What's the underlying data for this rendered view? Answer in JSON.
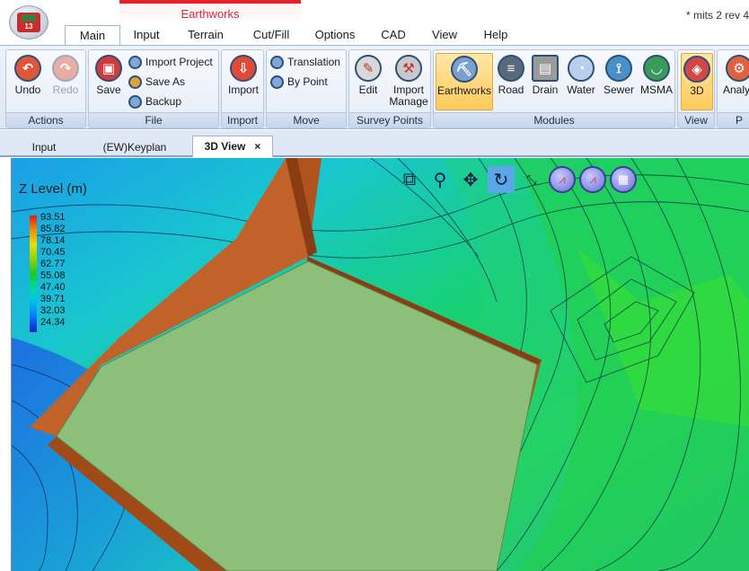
{
  "window": {
    "title": "* mits 2 rev 4",
    "context_group": "Earthworks"
  },
  "menu_tabs": [
    "Main",
    "Input",
    "Terrain",
    "Cut/Fill",
    "Options",
    "CAD",
    "View",
    "Help"
  ],
  "ribbon": {
    "actions": {
      "label": "Actions",
      "undo": "Undo",
      "redo": "Redo"
    },
    "file": {
      "label": "File",
      "save": "Save",
      "import_project": "Import Project",
      "save_as": "Save As",
      "backup": "Backup"
    },
    "import": {
      "label": "Import",
      "import": "Import"
    },
    "move": {
      "label": "Move",
      "translation": "Translation",
      "by_point": "By Point"
    },
    "survey_points": {
      "label": "Survey Points",
      "edit": "Edit",
      "import_manage_1": "Import",
      "import_manage_2": "Manage"
    },
    "modules": {
      "label": "Modules",
      "earthworks": "Earthworks",
      "road": "Road",
      "drain": "Drain",
      "water": "Water",
      "sewer": "Sewer",
      "msma": "MSMA"
    },
    "view": {
      "label": "View",
      "three_d": "3D"
    },
    "analysis": {
      "label": "P",
      "analys": "Analys"
    }
  },
  "doc_tabs": [
    {
      "label": "Input"
    },
    {
      "label": "(EW)Keyplan"
    },
    {
      "label": "3D View",
      "close": "×"
    }
  ],
  "viewport": {
    "legend_title": "Z Level (m)",
    "legend_values": [
      "93.51",
      "85.82",
      "78.14",
      "70.45",
      "62.77",
      "55.08",
      "47.40",
      "39.71",
      "32.03",
      "24.34"
    ]
  },
  "icons": {
    "view_toolbar": [
      "zoom-window-icon",
      "zoom-icon",
      "pan-icon",
      "rotate-icon",
      "zoom-extents-icon",
      "profile-icon",
      "section-icon",
      "print-view-icon"
    ]
  },
  "colors": {
    "cut_fill_slope": "#c0622a",
    "platform": "#8cc07a",
    "terrain_high": "#2ad44a",
    "terrain_low": "#1d5fe0",
    "selected_module": "#ffc95c",
    "context_accent": "#e8202a"
  }
}
